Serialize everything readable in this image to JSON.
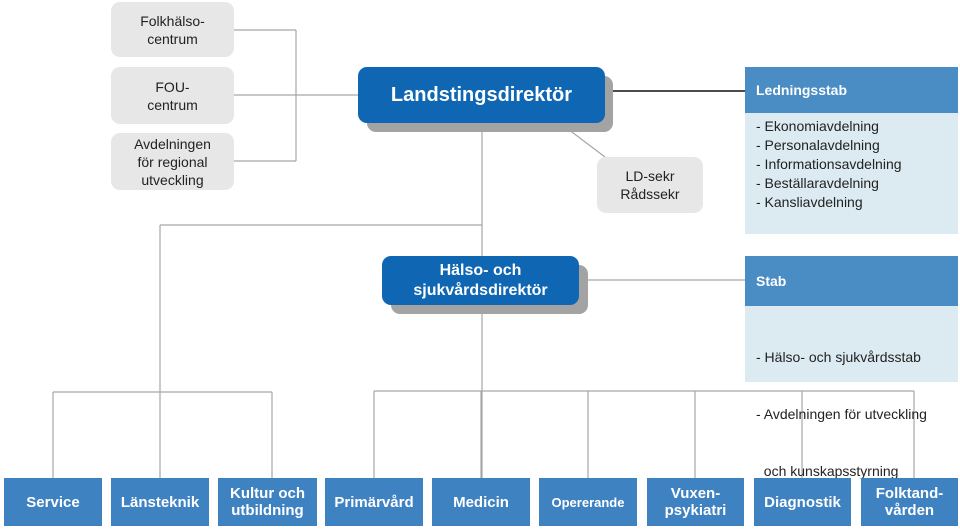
{
  "colors": {
    "director_blue": "#0f67b3",
    "staff_header_blue": "#4a8cc4",
    "staff_body_light": "#dcebf2",
    "unit_blue": "#3f82c1",
    "support_grey": "#e7e7e7",
    "connector_grey": "#a6a6a6"
  },
  "support_units": [
    {
      "label": "Folkhälso-\ncentrum"
    },
    {
      "label": "FOU-\ncentrum"
    },
    {
      "label": "Avdelningen\nför regional\nutveckling"
    }
  ],
  "county_director": {
    "label": "Landstingsdirektör"
  },
  "secretary": {
    "label": "LD-sekr\nRådssekr"
  },
  "management_staff": {
    "title": "Ledningsstab",
    "items": [
      "- Ekonomiavdelning",
      "- Personalavdelning",
      "- Informationsavdelning",
      "- Beställaravdelning",
      "- Kansliavdelning"
    ]
  },
  "health_director": {
    "label": "Hälso- och\nsjukvårdsdirektör"
  },
  "health_staff": {
    "title": "Stab",
    "items": [
      "- Hälso- och sjukvårdsstab",
      "- Avdelningen för utveckling",
      "  och kunskapsstyrning"
    ]
  },
  "operational_units": [
    {
      "label": "Service"
    },
    {
      "label": "Länsteknik"
    },
    {
      "label": "Kultur och\nutbildning"
    },
    {
      "label": "Primärvård"
    },
    {
      "label": "Medicin"
    },
    {
      "label": "Opererande"
    },
    {
      "label": "Vuxen-\npsykiatri"
    },
    {
      "label": "Diagnostik"
    },
    {
      "label": "Folktand-\nvården"
    }
  ]
}
